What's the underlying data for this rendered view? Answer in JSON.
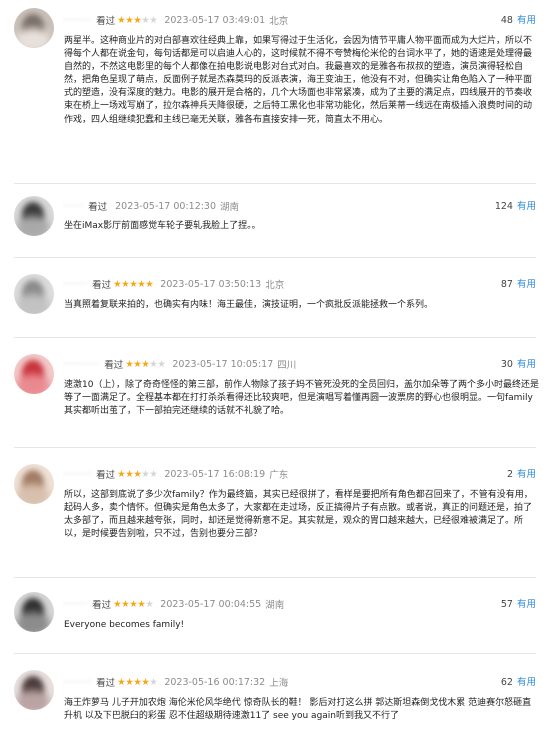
{
  "reviews": [
    {
      "username": "·······",
      "tag": "看过",
      "rating": 3,
      "time": "2023-05-17 03:49:01",
      "location": "北京",
      "votes": "48",
      "useful_label": "有用",
      "avatar_colors": [
        "#c9c0ba",
        "#7a6f66",
        "#e8e0da"
      ],
      "content": "两星半。这种商业片的对白部喜欢往经典上靠，如果写得过于生活化，会因为情节平庸人物平面而成为大烂片，所以不得每个人都在说金句，每句话都是可以启迪人心的，这时候就不得不夸赞梅伦米伦的台词水平了，她的语速是处理得最自然的，不然这电影里的每个人都像在拍电影说电影对台式对白。我最喜欢的是雅各布叔叔的塑造，演员演得轻松自然，把角色呈现了萌点，反面例子就是杰森莫玛的反派表演，海王变油王，他没有不对，但确实让角色陷入了一种平面式的塑造，没有深度的魅力。电影的展开是合格的，几个大场面也非常紧凑，成为了主要的满足点，四线展开的节奏收束在桥上一场戏写崩了，拉尔森神兵天降很硬，之后特工黑化也非常功能化，然后莱蒂一线远在南极插入浪费时间的动作戏，四人组继续犯蠢和主线已毫无关联，雅各布直接安排一死，简直太不用心。"
    },
    {
      "username": "·····",
      "tag": "看过",
      "rating": 0,
      "time": "2023-05-17 00:12:30",
      "location": "湖南",
      "votes": "124",
      "useful_label": "有用",
      "avatar_colors": [
        "#d8d8d8",
        "#3a3a3a",
        "#a9a9a9"
      ],
      "content": "坐在iMax影厅前面感觉车轮子要轧我脸上了捏。。"
    },
    {
      "username": "······",
      "tag": "看过",
      "rating": 5,
      "time": "2023-05-17 03:50:13",
      "location": "北京",
      "votes": "87",
      "useful_label": "有用",
      "avatar_colors": [
        "#dcdcdc",
        "#8a8a8a",
        "#c2c2c2"
      ],
      "content": "当真照着复联来拍的，也确实有内味！海王最佳，演技证明，一个疯批反派能拯救一个系列。"
    },
    {
      "username": "·········",
      "tag": "看过",
      "rating": 3,
      "time": "2023-05-17 10:05:17",
      "location": "四川",
      "votes": "30",
      "useful_label": "有用",
      "avatar_colors": [
        "#f3c9c9",
        "#c8323a",
        "#e98a90"
      ],
      "content": "速激10（上），除了奇奇怪怪的第三部，前作人物除了孩子妈不管死没死的全员回归，盖尔加朵等了两个多小时最终还是等了一面满足了。全程基本都在打打杀杀看得还比较爽吧，但是演唱写着懂再圆一波票房的野心也很明显。一句family其实都听出茧了，下一部拍完还继续的话就不礼貌了哈。"
    },
    {
      "username": "·······",
      "tag": "看过",
      "rating": 3,
      "time": "2023-05-17 16:08:19",
      "location": "广东",
      "votes": "2",
      "useful_label": "有用",
      "avatar_colors": [
        "#efe1d6",
        "#a07b63",
        "#d8c0ae"
      ],
      "content": "所以，这部到底说了多少次family？作为最终篇，其实已经很拼了，看样是要把所有角色都召回来了，不管有没有用，起码人多，卖个情怀。但确实是角色太多了，大家都在走过场，反正搞得片子有点散。或者说，真正的问题还是，拍了太多部了，而且越来越夸张，同时，却还是觉得新意不足。其实就是，观众的胃口越来越大，已经很难被满足了。所以，是时候要告别啦，只不过，告别也要分三部？"
    },
    {
      "username": "······",
      "tag": "看过",
      "rating": 4,
      "time": "2023-05-17 00:04:55",
      "location": "湖南",
      "votes": "57",
      "useful_label": "有用",
      "avatar_colors": [
        "#d5d5d5",
        "#2f2f2f",
        "#8c8c8c"
      ],
      "content": "Everyone becomes family!"
    },
    {
      "username": "·······",
      "tag": "看过",
      "rating": 4,
      "time": "2023-05-16 00:17:32",
      "location": "上海",
      "votes": "62",
      "useful_label": "有用",
      "avatar_colors": [
        "#e9dede",
        "#4a3a3a",
        "#b9a3a3"
      ],
      "content": "海王炸萝马 儿子开加农炮 海伦米伦风华绝代 惊奇队长的鞋！ 影后对打这么拼 郭达斯坦森倒戈伐木累 范迪赛尔怒砸直升机 以及下巴脱臼的彩蛋 忍不住超级期待速激11了 see you again听到我又不行了"
    }
  ]
}
